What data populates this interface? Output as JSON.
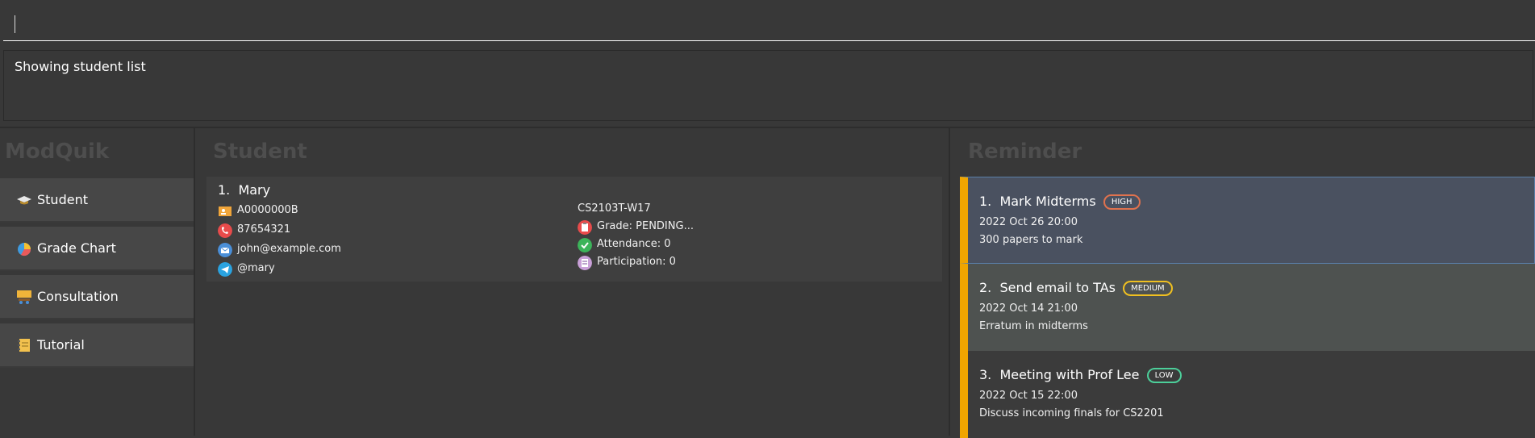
{
  "command": {
    "value": "",
    "placeholder": ""
  },
  "result": {
    "text": "Showing student list"
  },
  "app": {
    "title": "ModQuik"
  },
  "sidebar": {
    "items": [
      {
        "label": "Student",
        "icon": "student-cap-icon"
      },
      {
        "label": "Grade Chart",
        "icon": "pie-chart-icon"
      },
      {
        "label": "Consultation",
        "icon": "consultation-icon"
      },
      {
        "label": "Tutorial",
        "icon": "notebook-icon"
      }
    ]
  },
  "student_panel": {
    "title": "Student",
    "students": [
      {
        "index": "1.",
        "name": "Mary",
        "student_id": "A0000000B",
        "phone": "87654321",
        "email": "john@example.com",
        "telegram": "@mary",
        "tutorial": "CS2103T-W17",
        "grade": "Grade: PENDING...",
        "attendance": "Attendance: 0",
        "participation": "Participation: 0"
      }
    ]
  },
  "reminder_panel": {
    "title": "Reminder",
    "reminders": [
      {
        "index": "1.",
        "name": "Mark Midterms",
        "priority": "HIGH",
        "datetime": "2022 Oct 26 20:00",
        "description": "300 papers to mark"
      },
      {
        "index": "2.",
        "name": "Send email to TAs",
        "priority": "MEDIUM",
        "datetime": "2022 Oct 14 21:00",
        "description": "Erratum in midterms"
      },
      {
        "index": "3.",
        "name": "Meeting with Prof Lee",
        "priority": "LOW",
        "datetime": "2022 Oct 15 22:00",
        "description": "Discuss incoming finals for CS2201"
      }
    ]
  },
  "colors": {
    "accent": "#f0a500",
    "high": "#e0724e",
    "medium": "#f0c020",
    "low": "#4ccf9a",
    "selected_card": "#4a5160"
  }
}
